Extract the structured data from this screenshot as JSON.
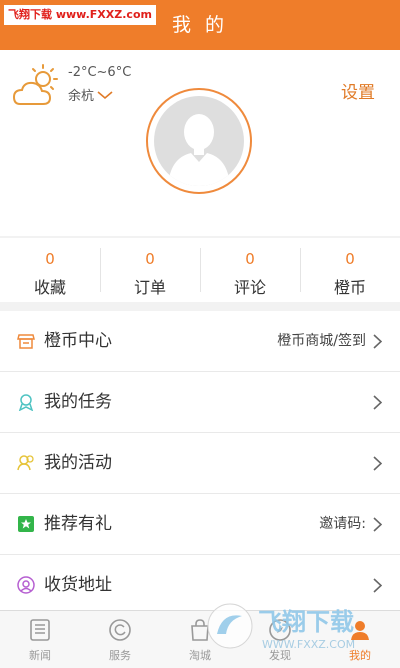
{
  "header": {
    "watermark": "飞翔下载 www.FXXZ.com",
    "title": "我 的"
  },
  "weather": {
    "icon": "partly-cloudy-icon",
    "temp": "-2°C~6°C",
    "city": "余杭"
  },
  "settings_label": "设置",
  "stats": [
    {
      "value": "0",
      "label": "收藏"
    },
    {
      "value": "0",
      "label": "订单"
    },
    {
      "value": "0",
      "label": "评论"
    },
    {
      "value": "0",
      "label": "橙币"
    }
  ],
  "menu": [
    {
      "icon": "shop-icon",
      "label": "橙币中心",
      "extra": "橙币商城/签到"
    },
    {
      "icon": "task-icon",
      "label": "我的任务",
      "extra": ""
    },
    {
      "icon": "activity-icon",
      "label": "我的活动",
      "extra": ""
    },
    {
      "icon": "gift-icon",
      "label": "推荐有礼",
      "extra": "邀请码:"
    },
    {
      "icon": "address-icon",
      "label": "收货地址",
      "extra": ""
    }
  ],
  "tabs": [
    {
      "icon": "news-icon",
      "label": "新闻"
    },
    {
      "icon": "service-icon",
      "label": "服务"
    },
    {
      "icon": "bag-icon",
      "label": "淘城"
    },
    {
      "icon": "discover-icon",
      "label": "发现"
    },
    {
      "icon": "user-icon",
      "label": "我的",
      "active": true
    }
  ],
  "brand_watermark": {
    "title": "飞翔下载",
    "url": "WWW.FXXZ.COM"
  },
  "colors": {
    "accent": "#ef7d2a",
    "settings": "#e07a26"
  }
}
